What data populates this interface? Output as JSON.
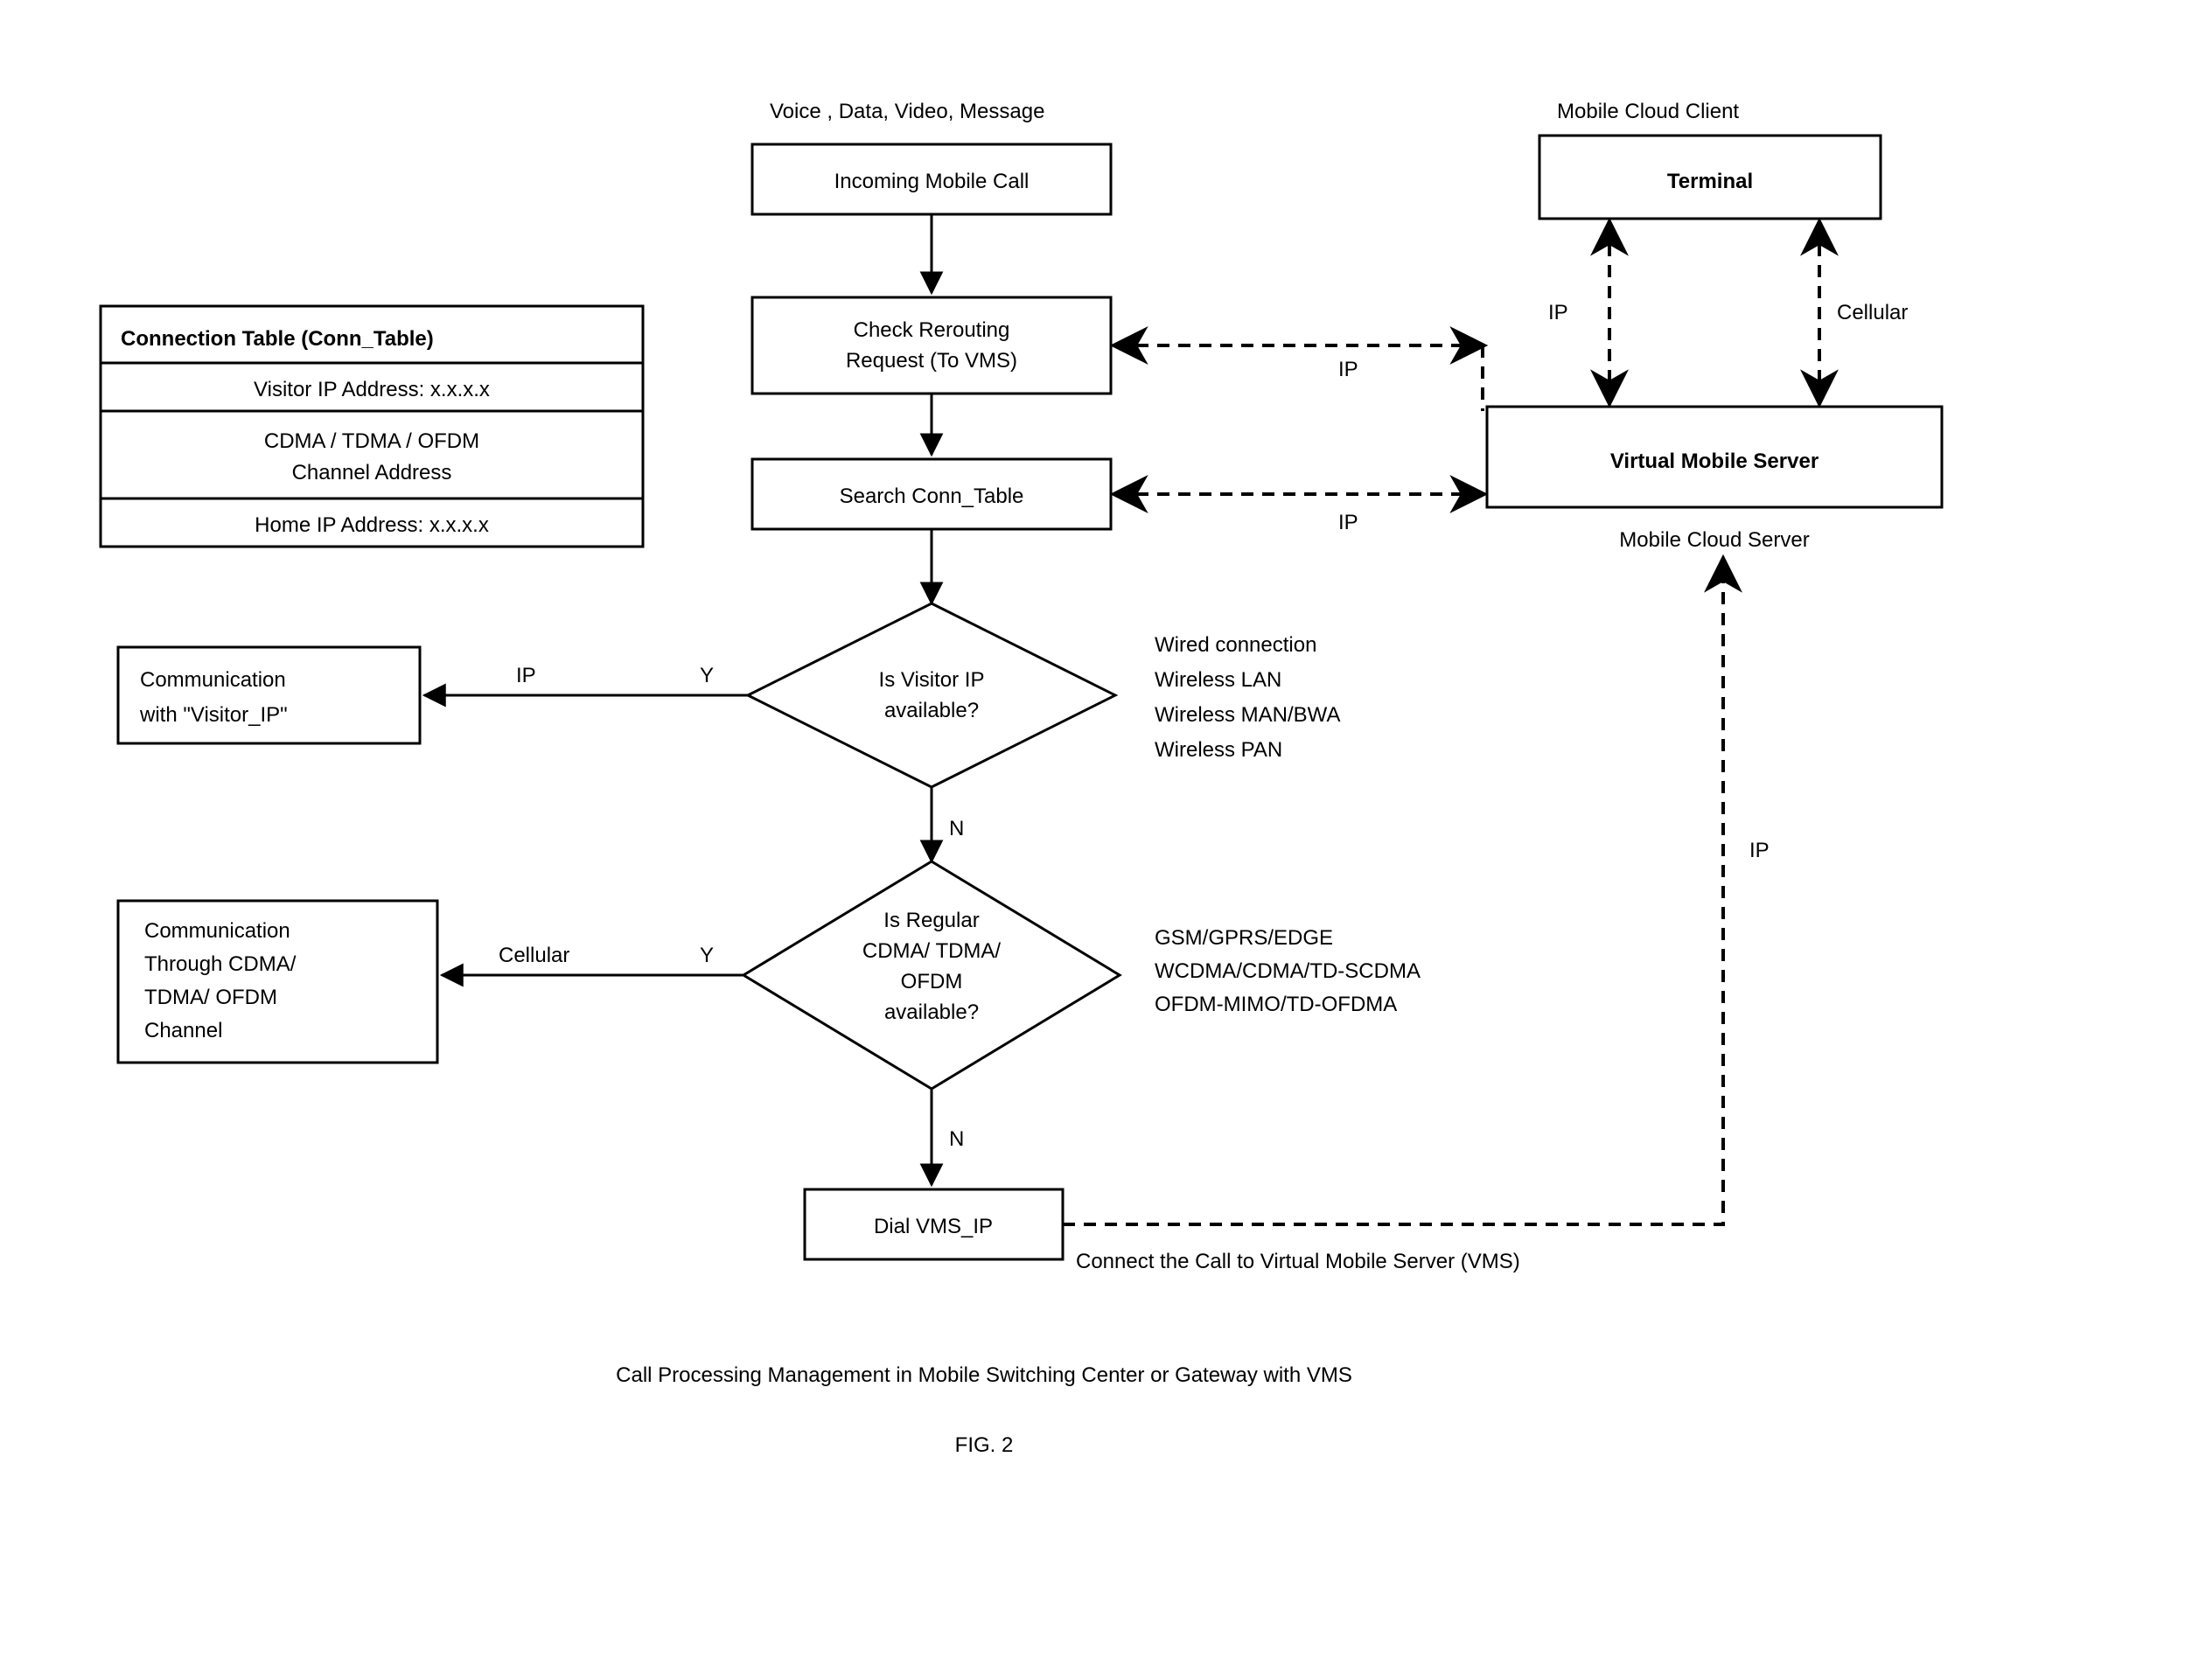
{
  "header1": "Voice , Data, Video, Message",
  "header2": "Mobile Cloud Client",
  "incoming": "Incoming Mobile Call",
  "terminal": "Terminal",
  "check1": "Check Rerouting",
  "check2": "Request (To VMS)",
  "search": "Search Conn_Table",
  "vms": "Virtual Mobile Server",
  "vmsSub": "Mobile Cloud  Server",
  "ipLbl": "IP",
  "cellLbl": "Cellular",
  "connHdr": "Connection Table (Conn_Table)",
  "connR1": "Visitor IP Address:  x.x.x.x",
  "connR2a": "CDMA / TDMA / OFDM",
  "connR2b": "Channel  Address",
  "connR3": "Home IP Address:  x.x.x.x",
  "d1a": "Is Visitor IP",
  "d1b": "available?",
  "d1s1": "Wired  connection",
  "d1s2": "Wireless LAN",
  "d1s3": "Wireless MAN/BWA",
  "d1s4": "Wireless PAN",
  "d2a": "Is Regular",
  "d2b": "CDMA/ TDMA/",
  "d2c": "OFDM",
  "d2d": "available?",
  "d2s1": "GSM/GPRS/EDGE",
  "d2s2": "WCDMA/CDMA/TD-SCDMA",
  "d2s3": "OFDM-MIMO/TD-OFDMA",
  "comm1a": "Communication",
  "comm1b": "with \"Visitor_IP\"",
  "comm2a": "Communication",
  "comm2b": "Through CDMA/",
  "comm2c": "TDMA/ OFDM",
  "comm2d": "Channel",
  "dial": "Dial  VMS_IP",
  "connectNote": "Connect the Call to Virtual Mobile Server (VMS)",
  "Y": "Y",
  "N": "N",
  "caption": "Call Processing Management in Mobile Switching Center or Gateway with  VMS",
  "fig": "FIG. 2"
}
